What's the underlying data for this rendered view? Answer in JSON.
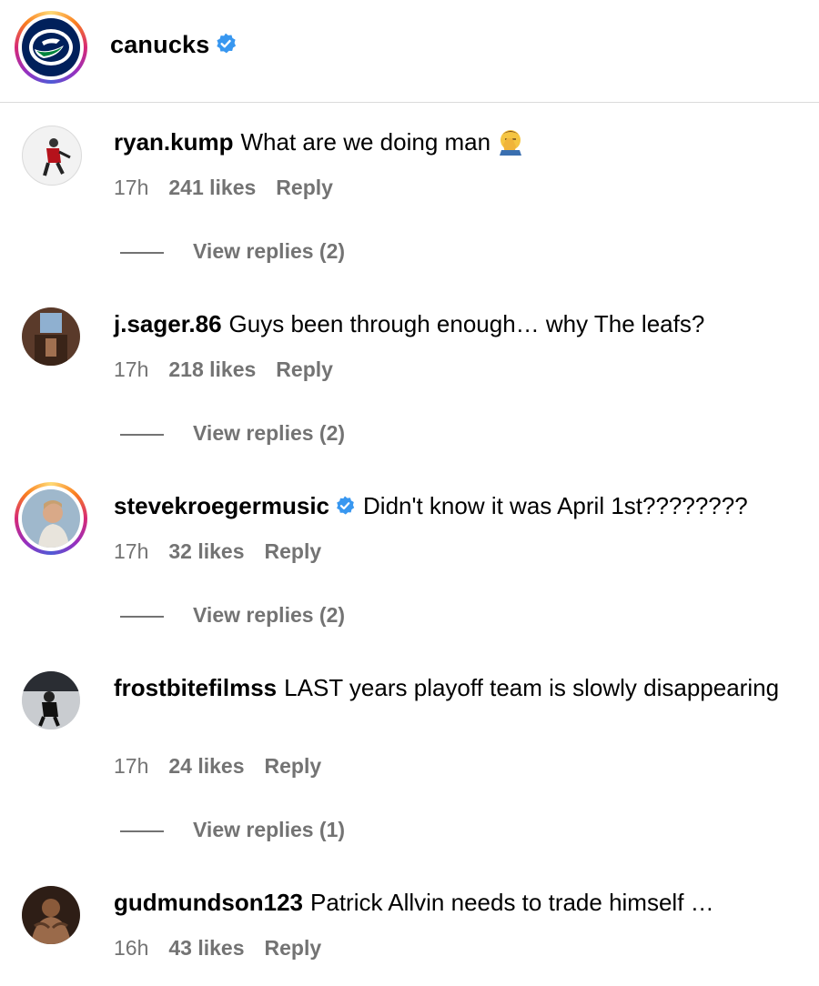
{
  "post": {
    "account": "canucks",
    "verified": true
  },
  "comments": [
    {
      "user": "ryan.kump",
      "text": "What are we doing man",
      "emoji": "face-palm-emoji",
      "time": "17h",
      "likes": "241 likes",
      "reply": "Reply",
      "view_replies": "View replies (2)"
    },
    {
      "user": "j.sager.86",
      "text": "Guys been through enough… why The leafs?",
      "time": "17h",
      "likes": "218 likes",
      "reply": "Reply",
      "view_replies": "View replies (2)"
    },
    {
      "user": "stevekroegermusic",
      "verified": true,
      "text": "Didn't know it was April 1st????????",
      "time": "17h",
      "likes": "32 likes",
      "reply": "Reply",
      "view_replies": "View replies (2)"
    },
    {
      "user": "frostbitefilmss",
      "text": "LAST years playoff team is slowly disappearing",
      "time": "17h",
      "likes": "24 likes",
      "reply": "Reply",
      "view_replies": "View replies (1)"
    },
    {
      "user": "gudmundson123",
      "text": "Patrick Allvin needs to trade himself …",
      "time": "16h",
      "likes": "43 likes",
      "reply": "Reply"
    }
  ],
  "colors": {
    "verified_blue": "#3897f0",
    "meta_gray": "#737373",
    "canucks_blue": "#00205b",
    "canucks_green": "#00843d"
  }
}
